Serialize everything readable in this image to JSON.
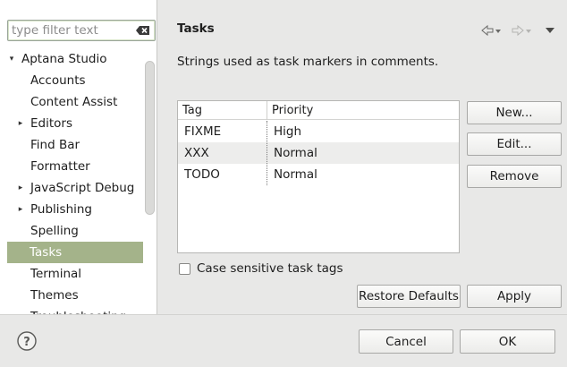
{
  "filter": {
    "placeholder": "type filter text"
  },
  "tree": {
    "items": [
      {
        "label": "Aptana Studio",
        "twisty": "▾",
        "level": 0,
        "selected": false
      },
      {
        "label": "Accounts",
        "twisty": "",
        "level": 1,
        "selected": false
      },
      {
        "label": "Content Assist",
        "twisty": "",
        "level": 1,
        "selected": false
      },
      {
        "label": "Editors",
        "twisty": "▸",
        "level": 1,
        "selected": false
      },
      {
        "label": "Find Bar",
        "twisty": "",
        "level": 1,
        "selected": false
      },
      {
        "label": "Formatter",
        "twisty": "",
        "level": 1,
        "selected": false
      },
      {
        "label": "JavaScript Debug",
        "twisty": "▸",
        "level": 1,
        "selected": false
      },
      {
        "label": "Publishing",
        "twisty": "▸",
        "level": 1,
        "selected": false
      },
      {
        "label": "Spelling",
        "twisty": "",
        "level": 1,
        "selected": false
      },
      {
        "label": "Tasks",
        "twisty": "",
        "level": 1,
        "selected": true
      },
      {
        "label": "Terminal",
        "twisty": "",
        "level": 1,
        "selected": false
      },
      {
        "label": "Themes",
        "twisty": "",
        "level": 1,
        "selected": false
      },
      {
        "label": "Troubleshooting",
        "twisty": "",
        "level": 1,
        "selected": false
      }
    ]
  },
  "page": {
    "title": "Tasks",
    "description": "Strings used as task markers in comments."
  },
  "nav": {
    "back_icon": "back-arrow-icon",
    "forward_icon": "forward-arrow-icon",
    "menu_icon": "view-menu-icon"
  },
  "table": {
    "headers": {
      "tag": "Tag",
      "priority": "Priority"
    },
    "rows": [
      {
        "tag": "FIXME",
        "priority": "High"
      },
      {
        "tag": "XXX",
        "priority": "Normal"
      },
      {
        "tag": "TODO",
        "priority": "Normal"
      }
    ]
  },
  "buttons": {
    "new": "New...",
    "edit": "Edit...",
    "remove": "Remove",
    "restore_defaults": "Restore Defaults",
    "apply": "Apply",
    "cancel": "Cancel",
    "ok": "OK"
  },
  "options": {
    "case_sensitive_label": "Case sensitive task tags",
    "case_sensitive_checked": false
  },
  "colors": {
    "selection": "#a4b38a",
    "alt_row": "#ededec",
    "background": "#e8e8e7"
  }
}
